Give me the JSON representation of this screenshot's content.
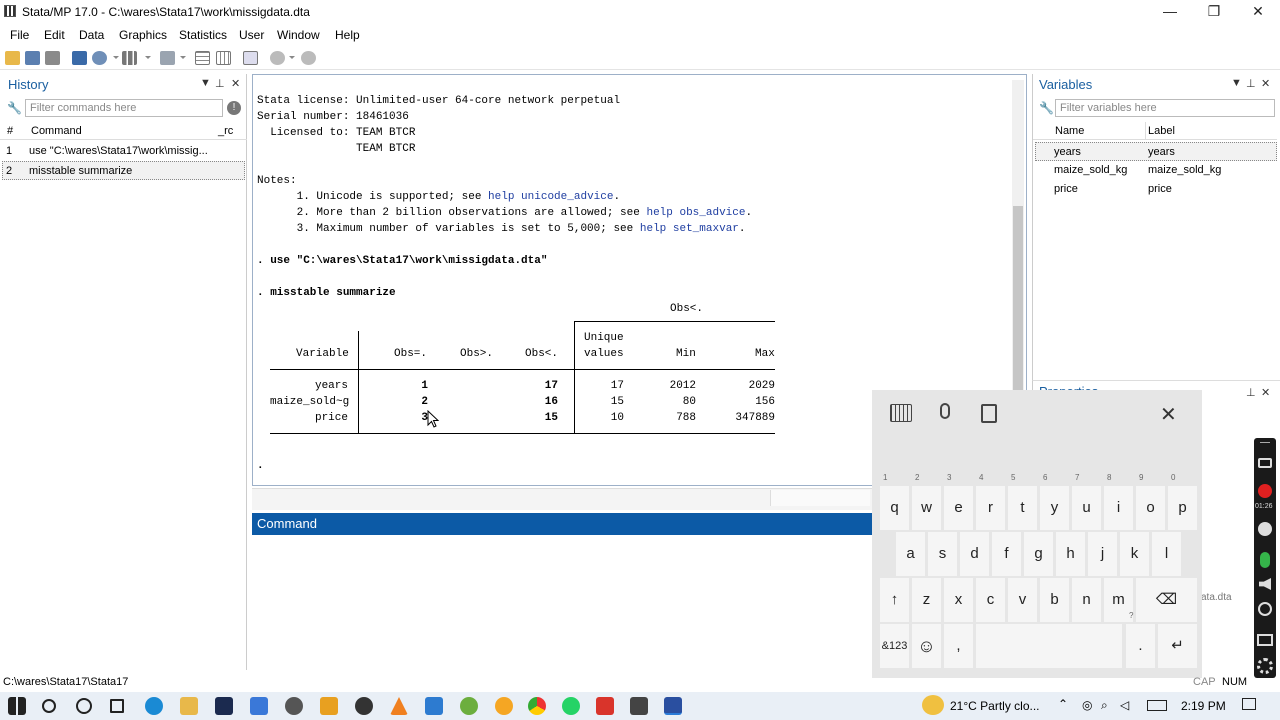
{
  "window": {
    "title": "Stata/MP 17.0 - C:\\wares\\Stata17\\work\\missigdata.dta",
    "min": "—",
    "max": "❐",
    "close": "✕"
  },
  "menu": [
    "File",
    "Edit",
    "Data",
    "Graphics",
    "Statistics",
    "User",
    "Window",
    "Help"
  ],
  "history": {
    "title": "History",
    "filter_placeholder": "Filter commands here",
    "col_num": "#",
    "col_cmd": "Command",
    "col_rc": "_rc",
    "rows": [
      {
        "n": "1",
        "cmd": "use \"C:\\wares\\Stata17\\work\\missig..."
      },
      {
        "n": "2",
        "cmd": "misstable summarize"
      }
    ]
  },
  "variables": {
    "title": "Variables",
    "filter_placeholder": "Filter variables here",
    "col_name": "Name",
    "col_label": "Label",
    "rows": [
      {
        "name": "years",
        "label": "years"
      },
      {
        "name": "maize_sold_kg",
        "label": "maize_sold_kg"
      },
      {
        "name": "price",
        "label": "price"
      }
    ]
  },
  "properties": {
    "title": "Properties",
    "partial": "ata.dta"
  },
  "results": {
    "license_lines": [
      "Stata license: Unlimited-user 64-core network perpetual",
      "Serial number: 18461036",
      "  Licensed to: TEAM BTCR",
      "               TEAM BTCR"
    ],
    "notes_title": "Notes:",
    "notes": [
      {
        "pre": "      1. Unicode is supported; see ",
        "link": "help unicode_advice",
        "post": "."
      },
      {
        "pre": "      2. More than 2 billion observations are allowed; see ",
        "link": "help obs_advice",
        "post": "."
      },
      {
        "pre": "      3. Maximum number of variables is set to 5,000; see ",
        "link": "help set_maxvar",
        "post": "."
      }
    ],
    "cmd1": ". use \"C:\\wares\\Stata17\\work\\missigdata.dta\"",
    "cmd2": ". misstable summarize",
    "table": {
      "group_header": "Obs<.",
      "headers": [
        "Variable",
        "Obs=.",
        "Obs>.",
        "Obs<.",
        "Unique",
        "values",
        "Min",
        "Max"
      ],
      "rows": [
        {
          "var": "years",
          "eq": "1",
          "gt": "",
          "lt": "17",
          "uniq": "17",
          "min": "2012",
          "max": "2029"
        },
        {
          "var": "maize_sold~g",
          "eq": "2",
          "gt": "",
          "lt": "16",
          "uniq": "15",
          "min": "80",
          "max": "156"
        },
        {
          "var": "price",
          "eq": "3",
          "gt": "",
          "lt": "15",
          "uniq": "10",
          "min": "788",
          "max": "347889"
        }
      ]
    },
    "prompt": "."
  },
  "command": {
    "title": "Command"
  },
  "status": {
    "path": "C:\\wares\\Stata17\\Stata17",
    "cap": "CAP",
    "num": "NUM"
  },
  "keyboard": {
    "row1": [
      {
        "k": "q",
        "n": "1"
      },
      {
        "k": "w",
        "n": "2"
      },
      {
        "k": "e",
        "n": "3"
      },
      {
        "k": "r",
        "n": "4"
      },
      {
        "k": "t",
        "n": "5"
      },
      {
        "k": "y",
        "n": "6"
      },
      {
        "k": "u",
        "n": "7"
      },
      {
        "k": "i",
        "n": "8"
      },
      {
        "k": "o",
        "n": "9"
      },
      {
        "k": "p",
        "n": "0"
      }
    ],
    "row2": [
      "a",
      "s",
      "d",
      "f",
      "g",
      "h",
      "j",
      "k",
      "l"
    ],
    "row3": [
      "↑",
      "z",
      "x",
      "c",
      "v",
      "b",
      "n",
      "m",
      "⌫"
    ],
    "row4": {
      "sym": "&123",
      "emoji": "☺",
      "comma": ",",
      "dot": ".",
      "q": "?",
      "enter": "↵"
    },
    "close": "✕"
  },
  "recorder": {
    "time": "01:26"
  },
  "taskbar": {
    "weather": "21°C  Partly clo...",
    "time": "2:19 PM"
  }
}
